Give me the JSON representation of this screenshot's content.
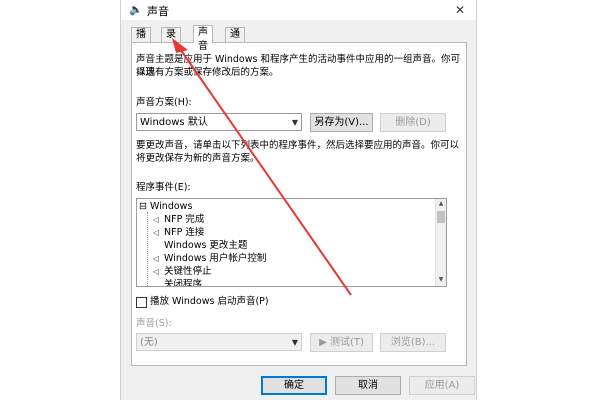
{
  "window": {
    "title": "声音",
    "close_glyph": "✕"
  },
  "tabs": [
    {
      "label": "播放"
    },
    {
      "label": "录制"
    },
    {
      "label": "声音"
    },
    {
      "label": "通信"
    }
  ],
  "panel": {
    "intro_line1": "声音主题是应用于 Windows 和程序产生的活动事件中应用的一组声音。你可以选",
    "intro_line2": "择现有方案或保存修改后的方案。",
    "scheme_label": "声音方案(H):",
    "scheme_value": "Windows 默认",
    "save_as_button": "另存为(V)...",
    "delete_button": "删除(D)",
    "change_line1": "要更改声音，请单击以下列表中的程序事件，然后选择要应用的声音。你可以",
    "change_line2": "将更改保存为新的声音方案。",
    "events_label": "程序事件(E):",
    "events": [
      {
        "label": "Windows",
        "has_sound": false,
        "is_root": true
      },
      {
        "label": "NFP 完成",
        "has_sound": true,
        "is_root": false
      },
      {
        "label": "NFP 连接",
        "has_sound": true,
        "is_root": false
      },
      {
        "label": "Windows 更改主题",
        "has_sound": false,
        "is_root": false
      },
      {
        "label": "Windows 用户帐户控制",
        "has_sound": true,
        "is_root": false
      },
      {
        "label": "关键性停止",
        "has_sound": true,
        "is_root": false
      },
      {
        "label": "关闭程序",
        "has_sound": false,
        "is_root": false
      }
    ],
    "startup_checkbox_label": "播放 Windows 启动声音(P)",
    "startup_checked": false,
    "sounds_label": "声音(S):",
    "sounds_value": "(无)",
    "test_button": "▶ 测试(T)",
    "browse_button": "浏览(B)..."
  },
  "footer": {
    "ok_button": "确定",
    "cancel_button": "取消",
    "apply_button": "应用(A)"
  },
  "colors": {
    "arrow": "#e53935",
    "focus": "#0078d7"
  }
}
